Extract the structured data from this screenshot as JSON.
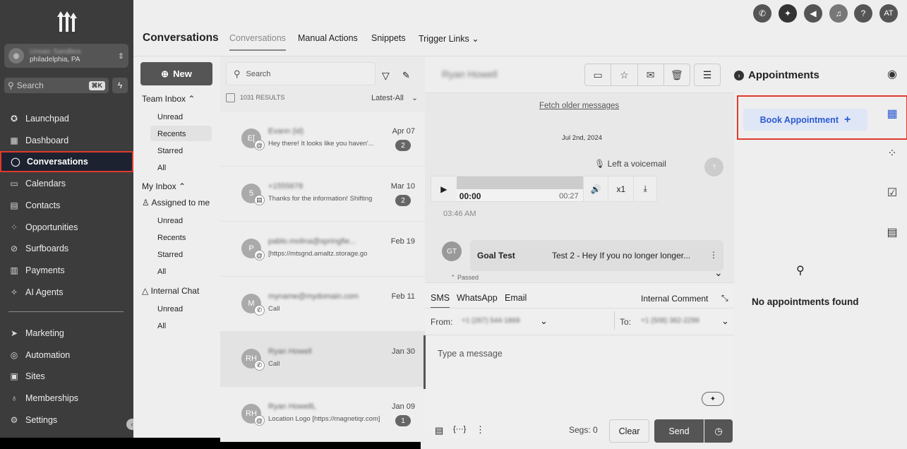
{
  "sidebar": {
    "account": {
      "name": "Unsaic Sandbox",
      "location": "philadelphia, PA"
    },
    "search": {
      "placeholder": "Search",
      "shortcut": "⌘K"
    },
    "nav": [
      {
        "label": "Launchpad",
        "icon": "rocket-icon",
        "glyph": "✪"
      },
      {
        "label": "Dashboard",
        "icon": "grid-icon",
        "glyph": "▦"
      },
      {
        "label": "Conversations",
        "icon": "chat-bubble-icon",
        "glyph": "◯"
      },
      {
        "label": "Calendars",
        "icon": "calendar-icon",
        "glyph": "▭"
      },
      {
        "label": "Contacts",
        "icon": "contacts-icon",
        "glyph": "▤"
      },
      {
        "label": "Opportunities",
        "icon": "opportunities-icon",
        "glyph": "⁘"
      },
      {
        "label": "Surfboards",
        "icon": "surfboard-icon",
        "glyph": "⊘"
      },
      {
        "label": "Payments",
        "icon": "payments-icon",
        "glyph": "▥"
      },
      {
        "label": "AI Agents",
        "icon": "sparkle-icon",
        "glyph": "✧"
      }
    ],
    "nav2": [
      {
        "label": "Marketing",
        "icon": "send-icon",
        "glyph": "➤"
      },
      {
        "label": "Automation",
        "icon": "automation-icon",
        "glyph": "◎"
      },
      {
        "label": "Sites",
        "icon": "sites-icon",
        "glyph": "▣"
      },
      {
        "label": "Memberships",
        "icon": "membership-icon",
        "glyph": "♁"
      },
      {
        "label": "Settings",
        "icon": "gear-icon",
        "glyph": "⚙"
      }
    ]
  },
  "topbar": {
    "title": "Conversations",
    "tabs": [
      "Conversations",
      "Manual Actions",
      "Snippets",
      "Trigger Links"
    ],
    "icons": [
      {
        "name": "phone-icon",
        "glyph": "✆"
      },
      {
        "name": "magic-icon",
        "glyph": "✦"
      },
      {
        "name": "megaphone-icon",
        "glyph": "📢"
      },
      {
        "name": "bell-icon",
        "glyph": "🔔"
      },
      {
        "name": "help-icon",
        "glyph": "?"
      },
      {
        "name": "avatar-icon",
        "glyph": "AT"
      }
    ]
  },
  "inbox": {
    "new_label": "New",
    "team_inbox": "Team Inbox",
    "team_items": [
      "Unread",
      "Recents",
      "Starred",
      "All"
    ],
    "my_inbox": "My Inbox",
    "assigned": "Assigned to me",
    "my_items": [
      "Unread",
      "Recents",
      "Starred",
      "All"
    ],
    "internal_chat": "Internal Chat",
    "internal_items": [
      "Unread",
      "All"
    ]
  },
  "list": {
    "search_placeholder": "Search",
    "results": "1031 RESULTS",
    "sort": "Latest-All",
    "items": [
      {
        "initials": "E[",
        "chip": "@",
        "name": "Evann (id)",
        "preview": "Hey there!  It looks like you haven'...",
        "date": "Apr 07",
        "badge": "2"
      },
      {
        "initials": "5",
        "chip": "▤",
        "name": "+1555678",
        "preview": "Thanks for the information! Shifting",
        "date": "Mar 10",
        "badge": "2"
      },
      {
        "initials": "P",
        "chip": "@",
        "name": "pablo.molina@springfie...",
        "preview": "[https://mtsgnd.amaltz.storage.go",
        "date": "Feb 19",
        "badge": ""
      },
      {
        "initials": "M",
        "chip": "✆",
        "name": "myname@mydomain.com",
        "preview": "Call",
        "date": "Feb 11",
        "badge": ""
      },
      {
        "initials": "RH",
        "chip": "✆",
        "name": "Ryan Howell",
        "preview": "Call",
        "date": "Jan 30",
        "badge": ""
      },
      {
        "initials": "RH",
        "chip": "@",
        "name": "Ryan HowellL",
        "preview": "Location Logo [https://magnetiqr.com]",
        "date": "Jan 09",
        "badge": "1"
      }
    ]
  },
  "chat": {
    "contact_name": "Ryan Howell",
    "fetch_older": "Fetch older messages",
    "date_sep": "Jul 2nd, 2024",
    "voicemail": "Left a voicemail",
    "time_current": "00:00",
    "time_total": "00:27",
    "speed": "x1",
    "msg_time": "03:46 AM",
    "msg_initials": "GT",
    "msg_from": "Goal Test",
    "msg_text": "Test 2  -  Hey If you no longer longer...",
    "passed": "Passed"
  },
  "composer": {
    "tabs": [
      "SMS",
      "WhatsApp",
      "Email"
    ],
    "internal": "Internal Comment",
    "from_label": "From:",
    "from_value": "+1 (267) 544-1869",
    "to_label": "To:",
    "to_value": "+1 (508) 382-2299",
    "placeholder": "Type a message",
    "segs": "Segs: 0",
    "clear": "Clear",
    "send": "Send"
  },
  "appointments": {
    "title": "Appointments",
    "book": "Book Appointment",
    "empty": "No appointments found"
  }
}
